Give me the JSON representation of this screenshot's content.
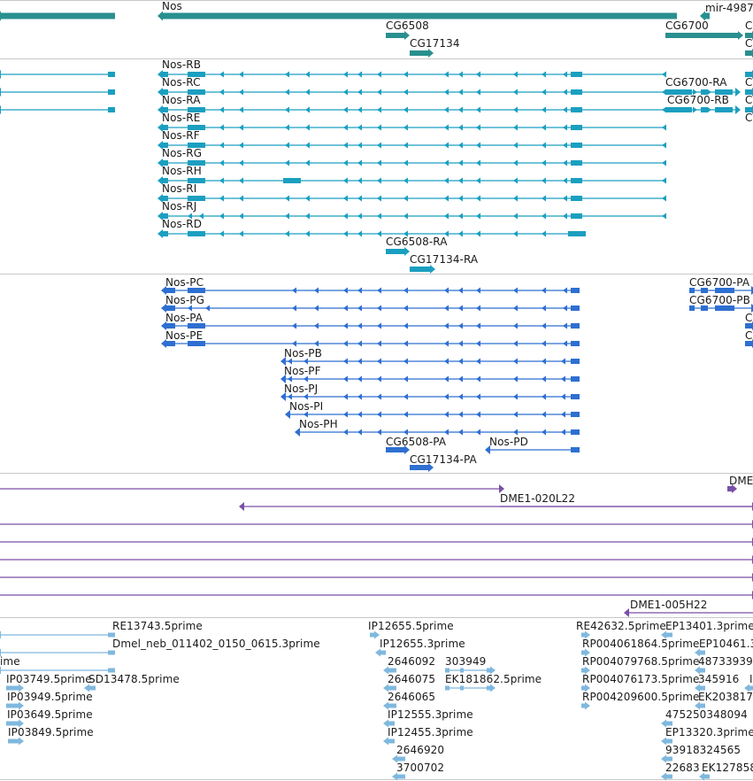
{
  "colors": {
    "gene": "#2a8f8f",
    "tx_flybase": "#1b9fc0",
    "tx_protein": "#2e6fd1",
    "clone": "#7a4fa6",
    "est": "#7fb8de",
    "separator": "#c8c8c8"
  },
  "tracks": [
    {
      "id": "genes",
      "kind": "gene",
      "features": [
        {
          "label": "",
          "dir": "-"
        },
        {
          "label": "Nos",
          "dir": "-"
        },
        {
          "label": "mir-4987",
          "dir": "-"
        },
        {
          "label": "CG6508",
          "dir": "+"
        },
        {
          "label": "CG6700",
          "dir": "+"
        },
        {
          "label": "C",
          "dir": "+"
        },
        {
          "label": "CG17134",
          "dir": "+"
        },
        {
          "label": "C",
          "dir": "+"
        }
      ]
    },
    {
      "id": "transcripts",
      "kind": "tx_flybase",
      "features": [
        {
          "label": "",
          "dir": "-"
        },
        {
          "label": "",
          "dir": "-"
        },
        {
          "label": "",
          "dir": "-"
        },
        {
          "label": "Nos-RB",
          "dir": "-"
        },
        {
          "label": "Nos-RC",
          "dir": "-"
        },
        {
          "label": "Nos-RA",
          "dir": "-"
        },
        {
          "label": "Nos-RE",
          "dir": "-"
        },
        {
          "label": "Nos-RF",
          "dir": "-"
        },
        {
          "label": "Nos-RG",
          "dir": "-"
        },
        {
          "label": "Nos-RH",
          "dir": "-"
        },
        {
          "label": "Nos-RI",
          "dir": "-"
        },
        {
          "label": "Nos-RJ",
          "dir": "-"
        },
        {
          "label": "Nos-RD",
          "dir": "-"
        },
        {
          "label": "CG6508-RA",
          "dir": "+"
        },
        {
          "label": "CG17134-RA",
          "dir": "+"
        },
        {
          "label": "CG6700-RA",
          "dir": "+"
        },
        {
          "label": "CG6700-RB",
          "dir": "+"
        },
        {
          "label": "C",
          "dir": "+"
        },
        {
          "label": "C",
          "dir": "+"
        },
        {
          "label": "C",
          "dir": "+"
        }
      ]
    },
    {
      "id": "proteins",
      "kind": "tx_protein",
      "features": [
        {
          "label": "Nos-PC",
          "dir": "-"
        },
        {
          "label": "Nos-PG",
          "dir": "-"
        },
        {
          "label": "Nos-PA",
          "dir": "-"
        },
        {
          "label": "Nos-PE",
          "dir": "-"
        },
        {
          "label": "Nos-PB",
          "dir": "-"
        },
        {
          "label": "Nos-PF",
          "dir": "-"
        },
        {
          "label": "Nos-PJ",
          "dir": "-"
        },
        {
          "label": "Nos-PI",
          "dir": "-"
        },
        {
          "label": "Nos-PH",
          "dir": "-"
        },
        {
          "label": "CG6508-PA",
          "dir": "+"
        },
        {
          "label": "Nos-PD",
          "dir": "-"
        },
        {
          "label": "CG17134-PA",
          "dir": "+"
        },
        {
          "label": "CG6700-PA",
          "dir": "+"
        },
        {
          "label": "CG6700-PB",
          "dir": "+"
        },
        {
          "label": "C",
          "dir": "+"
        },
        {
          "label": "C",
          "dir": "+"
        }
      ]
    },
    {
      "id": "clones",
      "kind": "clone",
      "features": [
        {
          "label": "DME",
          "dir": "+"
        },
        {
          "label": "",
          "dir": "+"
        },
        {
          "label": "",
          "dir": "-"
        },
        {
          "label": "DME1-020L22",
          "dir": "+"
        },
        {
          "label": "",
          "dir": "+"
        },
        {
          "label": "",
          "dir": "+"
        },
        {
          "label": "",
          "dir": "+"
        },
        {
          "label": "",
          "dir": "+"
        },
        {
          "label": "",
          "dir": "+"
        },
        {
          "label": "DME1-005H22",
          "dir": "-"
        }
      ]
    },
    {
      "id": "ests",
      "kind": "est",
      "features": [
        {
          "label": "RE13743.5prime",
          "dir": "-"
        },
        {
          "label": "Dmel_neb_011402_0150_0615.3prime",
          "dir": "-"
        },
        {
          "label": "ime",
          "dir": "-"
        },
        {
          "label": "IP03749.5prime",
          "dir": "+"
        },
        {
          "label": "SD13478.5prime",
          "dir": "-"
        },
        {
          "label": "IP03949.5prime",
          "dir": "+"
        },
        {
          "label": "IP03649.5prime",
          "dir": "+"
        },
        {
          "label": "IP03849.5prime",
          "dir": "+"
        },
        {
          "label": "IP12655.5prime",
          "dir": "+"
        },
        {
          "label": "IP12655.3prime",
          "dir": "-"
        },
        {
          "label": "2646092",
          "dir": "-"
        },
        {
          "label": "303949",
          "dir": "+"
        },
        {
          "label": "2646075",
          "dir": "-"
        },
        {
          "label": "EK181862.5prime",
          "dir": "+"
        },
        {
          "label": "2646065",
          "dir": "-"
        },
        {
          "label": "IP12555.3prime",
          "dir": "-"
        },
        {
          "label": "IP12455.3prime",
          "dir": "-"
        },
        {
          "label": "2646920",
          "dir": "-"
        },
        {
          "label": "3700702",
          "dir": "-"
        },
        {
          "label": "RE42632.5prime",
          "dir": "+"
        },
        {
          "label": "EP13401.3prime",
          "dir": "-"
        },
        {
          "label": "RP004061864.5prime",
          "dir": "+"
        },
        {
          "label": "EP10461.3",
          "dir": "-"
        },
        {
          "label": "RP004079768.5prime",
          "dir": "+"
        },
        {
          "label": "48733939",
          "dir": "-"
        },
        {
          "label": "RP004076173.5prime",
          "dir": "+"
        },
        {
          "label": "345916",
          "dir": "-"
        },
        {
          "label": "I",
          "dir": "-"
        },
        {
          "label": "RP004209600.5prime",
          "dir": "+"
        },
        {
          "label": "EK203817",
          "dir": "-"
        },
        {
          "label": "475250348094",
          "dir": "-"
        },
        {
          "label": "EP13320.3prime",
          "dir": "-"
        },
        {
          "label": "93918324565",
          "dir": "-"
        },
        {
          "label": "22683",
          "dir": "-"
        },
        {
          "label": "EK127858",
          "dir": "-"
        }
      ]
    }
  ]
}
